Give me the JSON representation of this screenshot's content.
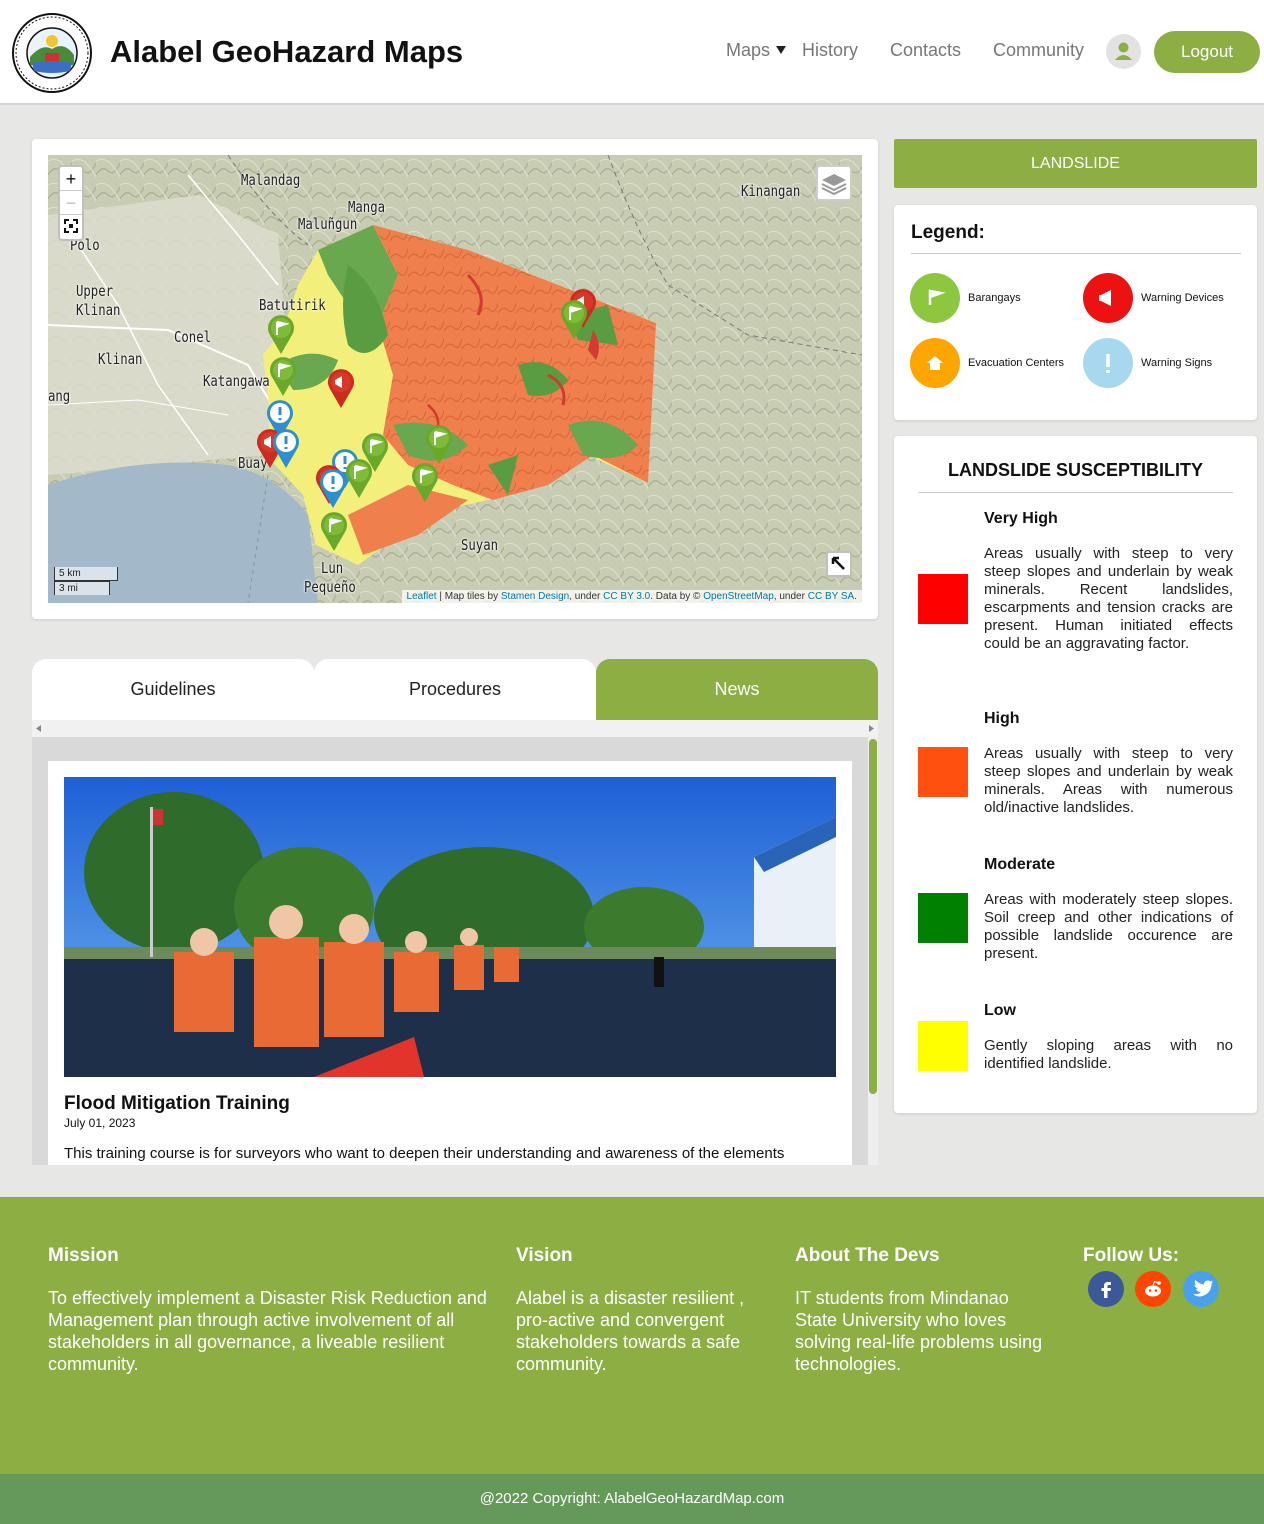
{
  "header": {
    "site_title": "Alabel GeoHazard Maps",
    "nav": {
      "maps": "Maps",
      "history": "History",
      "contacts": "Contacts",
      "community": "Community"
    },
    "logout_label": "Logout",
    "logo_text": "MUNICIPALITY OF ALABEL SARANGANI PROVINCE SEAL"
  },
  "map": {
    "places": {
      "malandag": "Malandag",
      "manga": "Manga",
      "malungun": "Maluñgun",
      "kinangan": "Kinangan",
      "polo": "Polo",
      "upper_klinan": "Upper",
      "upper_klinan2": "Klinan",
      "batutirik": "Batutirik",
      "conel": "Conel",
      "klinan": "Klinan",
      "katangawan": "Katangawa",
      "ang": "ang",
      "buayan": "Buay",
      "suyan": "Suyan",
      "lun": "Lun",
      "pequeno": "Pequeño"
    },
    "zoom_in": "+",
    "zoom_out": "−",
    "scale_km": "5 km",
    "scale_mi": "3 mi",
    "attribution": {
      "leaflet": "Leaflet",
      "t1": " | Map tiles by ",
      "stamen": "Stamen Design",
      "t2": ", under ",
      "ccby": "CC BY 3.0",
      "t3": ". Data by © ",
      "osm": "OpenStreetMap",
      "t4": ", under ",
      "ccbysa": "CC BY SA",
      "t5": "."
    }
  },
  "tabs": {
    "guidelines": "Guidelines",
    "procedures": "Procedures",
    "news": "News"
  },
  "news": {
    "title": "Flood Mitigation Training",
    "date": "July 01, 2023",
    "body": "This training course is for surveyors who want to deepen their understanding and awareness of the elements"
  },
  "side": {
    "hazard_button": "LANDSLIDE",
    "legend_title": "Legend:",
    "legend": {
      "barangays": "Barangays",
      "warning_devices": "Warning Devices",
      "evacuation_centers": "Evacuation Centers",
      "warning_signs": "Warning Signs"
    },
    "legend_colors": {
      "barangays": "#8dc63f",
      "warning_devices": "#ee1111",
      "evacuation_centers": "#ffa500",
      "warning_signs": "#a7d8f0"
    },
    "susceptibility_title": "LANDSLIDE SUSCEPTIBILITY",
    "levels": [
      {
        "name": "Very High",
        "color": "#ff0000",
        "desc": "Areas usually with steep to very steep slopes and underlain by weak minerals. Recent landslides, escarpments and tension cracks are present. Human initiated effects could be an aggravating factor."
      },
      {
        "name": "High",
        "color": "#ff5010",
        "desc": "Areas usually with steep to very steep slopes and underlain by weak minerals. Areas with numerous old/inactive landslides."
      },
      {
        "name": "Moderate",
        "color": "#008000",
        "desc": "Areas with moderately steep slopes. Soil creep and other indications of possible landslide occurence are present."
      },
      {
        "name": "Low",
        "color": "#ffff00",
        "desc": "Gently sloping areas with no identified landslide."
      }
    ]
  },
  "footer": {
    "mission_title": "Mission",
    "mission_text": "To effectively implement a Disaster Risk Reduction and Management plan through active involvement of all stakeholders in all governance, a liveable resilient community.",
    "vision_title": "Vision",
    "vision_text": "Alabel is a disaster resilient , pro-active and convergent stakeholders towards a safe community.",
    "devs_title": "About The Devs",
    "devs_text": "IT students from Mindanao State University who loves solving real-life problems using technologies.",
    "follow_title": "Follow Us:",
    "social_icons": [
      "facebook-icon",
      "reddit-icon",
      "twitter-icon"
    ],
    "copyright": "@2022 Copyright: AlabelGeoHazardMap.com"
  }
}
